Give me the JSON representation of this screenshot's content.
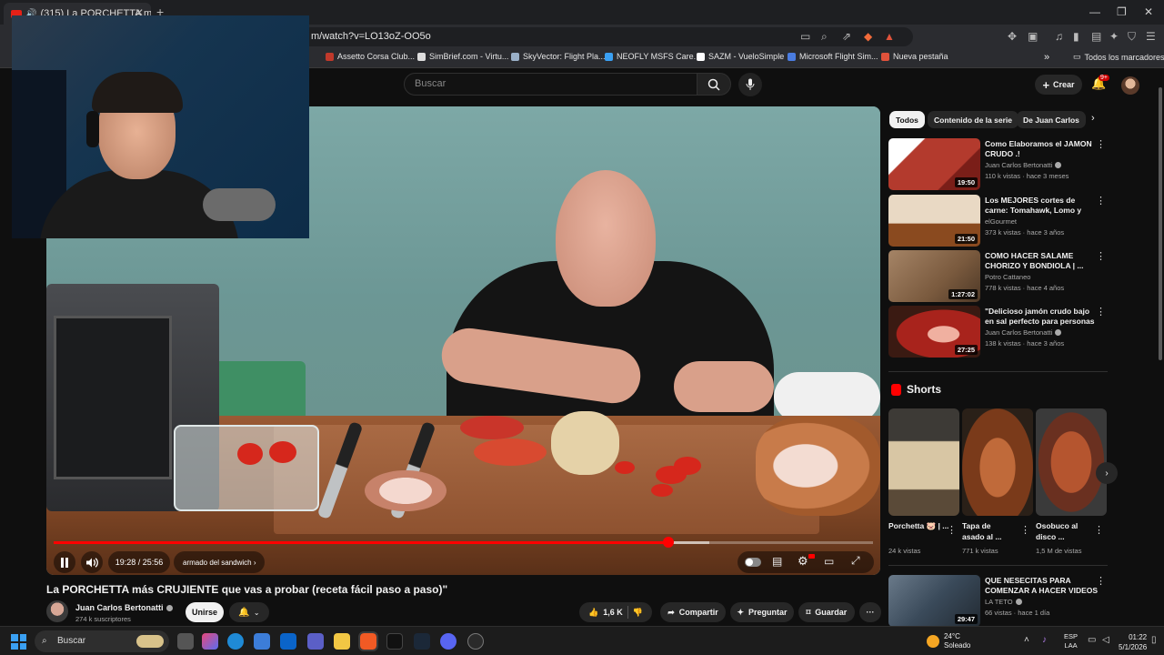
{
  "browser": {
    "tab_title": "(315) La PORCHETTA más CR",
    "tab_speaker": "🔊",
    "tab_close": "✕",
    "new_tab": "+",
    "win_min": "—",
    "win_max": "❐",
    "win_close": "✕",
    "url": "m/watch?v=LO13oZ-OO5o",
    "bookmarks": [
      {
        "label": "Assetto Corsa Club...",
        "color": "#c0392b"
      },
      {
        "label": "SimBrief.com - Virtu...",
        "color": "#dddddd"
      },
      {
        "label": "SkyVector: Flight Pla...",
        "color": "#9ab0c8"
      },
      {
        "label": "NEOFLY MSFS Care...",
        "color": "#3aa0f3"
      },
      {
        "label": "SAZM - VueloSimple",
        "color": "#ffffff"
      },
      {
        "label": "Microsoft Flight Sim...",
        "color": "#4a7ce0"
      },
      {
        "label": "Nueva pestaña",
        "color": "#e0523b"
      }
    ],
    "bookmarks_more": "»",
    "all_bookmarks": "Todos los marcadores"
  },
  "youtube": {
    "search_placeholder": "Buscar",
    "create_label": "Crear",
    "notifications_badge": "9+"
  },
  "player": {
    "time": "19:28 / 25:56",
    "chapter": "armado del sandwich ›",
    "progress_fraction": 0.75,
    "buffer_fraction": 0.8
  },
  "video": {
    "title": "La PORCHETTA más CRUJIENTE que vas a probar (receta fácil paso a paso)\"",
    "channel": "Juan Carlos Bertonatti",
    "subscribers": "274 k suscriptores",
    "join_label": "Unirse",
    "likes": "1,6 K",
    "share_label": "Compartir",
    "ask_label": "Preguntar",
    "save_label": "Guardar",
    "more_label": "···"
  },
  "sidebar": {
    "chips": [
      {
        "label": "Todos",
        "active": true
      },
      {
        "label": "Contenido de la serie",
        "active": false
      },
      {
        "label": "De Juan Carlos",
        "active": false
      }
    ],
    "recommendations": [
      {
        "title": "Como Elaboramos el JAMON CRUDO .!",
        "channel": "Juan Carlos Bertonatti",
        "verified": true,
        "meta": "110 k vistas · hace 3 meses",
        "duration": "19:50",
        "thumb": "#b33a2d"
      },
      {
        "title": "Los MEJORES cortes de carne: Tomahawk, Lomo y Marucha ...",
        "channel": "elGourmet",
        "verified": false,
        "meta": "373 k vistas · hace 3 años",
        "duration": "21:50",
        "thumb": "#8a4a1f"
      },
      {
        "title": "COMO HACER SALAME CHORIZO Y BONDIOLA | ...",
        "channel": "Potro Cattaneo",
        "verified": false,
        "meta": "778 k vistas · hace 4 años",
        "duration": "1:27:02",
        "thumb": "#7a5a3e"
      },
      {
        "title": "\"Delicioso jamón crudo bajo en sal perfecto para personas co...",
        "channel": "Juan Carlos Bertonatti",
        "verified": true,
        "meta": "138 k vistas · hace 3 años",
        "duration": "27:25",
        "thumb": "#a8231c"
      },
      {
        "title": "QUE NESECITAS PARA COMENZAR A HACER VIDEOS ...",
        "channel": "LA TETO",
        "verified": true,
        "meta": "66 vistas · hace 1 día",
        "duration": "29:47",
        "thumb": "#3a4a5a"
      }
    ],
    "shorts_title": "Shorts",
    "shorts": [
      {
        "title": "Porchetta 🐷 | ...",
        "views": "24 k vistas",
        "thumb": "#6b5a48"
      },
      {
        "title": "Tapa de asado al ...",
        "views": "771 k vistas",
        "thumb": "#7a3a1a"
      },
      {
        "title": "Osobuco al disco ...",
        "views": "1,5 M de vistas",
        "thumb": "#8a3a22"
      }
    ]
  },
  "taskbar": {
    "search": "Buscar",
    "temperature": "24°C",
    "weather": "Soleado",
    "lang_top": "ESP",
    "lang_bottom": "LAA",
    "time": "01:22",
    "date": "5/1/2026"
  }
}
